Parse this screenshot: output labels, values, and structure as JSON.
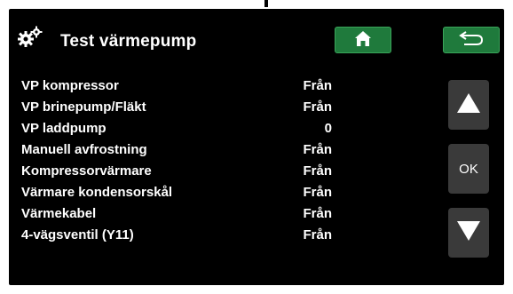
{
  "header": {
    "title": "Test värmepump",
    "settings_icon": "gears-icon",
    "home_icon": "home-icon",
    "back_icon": "back-arrow-icon",
    "accent_color": "#1f7a3c"
  },
  "params": [
    {
      "name": "VP kompressor",
      "value": "Från"
    },
    {
      "name": "VP brinepump/Fläkt",
      "value": "Från"
    },
    {
      "name": "VP laddpump",
      "value": "0"
    },
    {
      "name": "Manuell avfrostning",
      "value": "Från"
    },
    {
      "name": "Kompressorvärmare",
      "value": "Från"
    },
    {
      "name": "Värmare kondensorskål",
      "value": "Från"
    },
    {
      "name": "Värmekabel",
      "value": "Från"
    },
    {
      "name": "4-vägsventil (Y11)",
      "value": "Från"
    }
  ],
  "nav": {
    "up_icon": "triangle-up-icon",
    "ok_label": "OK",
    "down_icon": "triangle-down-icon"
  }
}
